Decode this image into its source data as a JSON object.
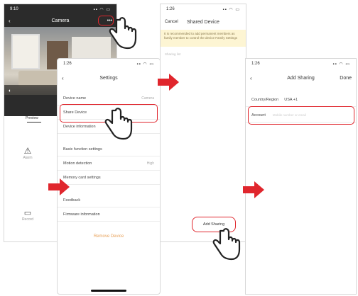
{
  "camera_screen": {
    "time": "9:10",
    "title": "Camera",
    "more_label": "•••",
    "tab_label": "Preview",
    "grid_items": [
      "Alarm",
      "Record"
    ]
  },
  "settings_screen": {
    "time": "1:26",
    "title": "Settings",
    "items": [
      {
        "label": "Device name",
        "value": "Camera"
      },
      {
        "label": "Share Device",
        "value": ""
      },
      {
        "label": "Device information",
        "value": ""
      },
      {
        "label": "Basic function settings",
        "value": ""
      },
      {
        "label": "Motion detection",
        "value": "High"
      },
      {
        "label": "Memory card settings",
        "value": ""
      },
      {
        "label": "Feedback",
        "value": ""
      },
      {
        "label": "Firmware information",
        "value": ""
      }
    ],
    "remove_label": "Remove Device"
  },
  "shared_screen": {
    "time": "1:26",
    "cancel_label": "Cancel",
    "title": "Shared Device",
    "notice": "It is recommended to add permanent members as family member to control the device Family Settings",
    "list_label": "Sharing list",
    "add_sharing_label": "Add Sharing"
  },
  "add_sharing_screen": {
    "time": "1:26",
    "title": "Add Sharing",
    "done_label": "Done",
    "country_label": "Country/Region",
    "country_value": "USA +1",
    "account_label": "Account",
    "account_placeholder": "Mobile number or email"
  },
  "colors": {
    "accent": "#e0262d",
    "notice_bg": "#fdf5d3",
    "remove": "#e8a25a"
  }
}
